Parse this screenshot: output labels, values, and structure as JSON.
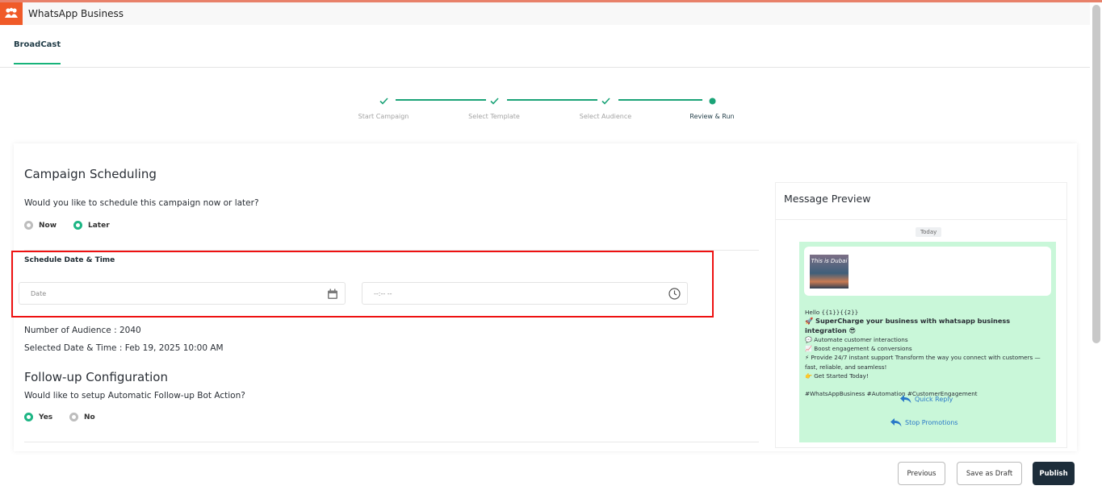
{
  "app": {
    "title": "WhatsApp Business"
  },
  "tabs": [
    {
      "label": "BroadCast"
    }
  ],
  "steps": [
    {
      "label": "Start Campaign",
      "status": "done"
    },
    {
      "label": "Select Template",
      "status": "done"
    },
    {
      "label": "Select Audience",
      "status": "done"
    },
    {
      "label": "Review & Run",
      "status": "active"
    }
  ],
  "scheduling": {
    "title": "Campaign Scheduling",
    "question": "Would you like to schedule this campaign now or later?",
    "options": [
      {
        "label": "Now",
        "selected": false
      },
      {
        "label": "Later",
        "selected": true
      }
    ],
    "datetime_label": "Schedule Date & Time",
    "date_placeholder": "Date",
    "time_placeholder": "--:-- --",
    "audience_text": "Number of Audience : 2040",
    "selected_text": "Selected Date & Time : Feb 19, 2025 10:00 AM"
  },
  "followup": {
    "title": "Follow-up Configuration",
    "question": "Would like to setup Automatic Follow-up Bot Action?",
    "options": [
      {
        "label": "Yes",
        "selected": true
      },
      {
        "label": "No",
        "selected": false
      }
    ]
  },
  "preview": {
    "title": "Message Preview",
    "day": "Today",
    "image_caption": "This is Dubai",
    "lines": [
      "Hello {{1}}{{2}}",
      "🚀 SuperCharge your business with whatsapp business integration 😎",
      "💬 Automate customer interactions",
      "📈 Boost engagement & conversions",
      "⚡ Provide 24/7 instant support Transform the way you connect with customers —fast, reliable, and seamless!",
      "👉 Get Started Today!",
      "",
      "#WhatsAppBusiness #Automation #CustomerEngagement"
    ],
    "quick_replies": [
      "Quick Reply",
      "Stop Promotions"
    ]
  },
  "actions": {
    "previous": "Previous",
    "draft": "Save as Draft",
    "publish": "Publish"
  },
  "colors": {
    "accent": "#1aa377",
    "highlight": "#ee1111",
    "bubble": "#c9f7d9",
    "primary_button": "#1d2d3a",
    "brand": "#f05a28"
  }
}
